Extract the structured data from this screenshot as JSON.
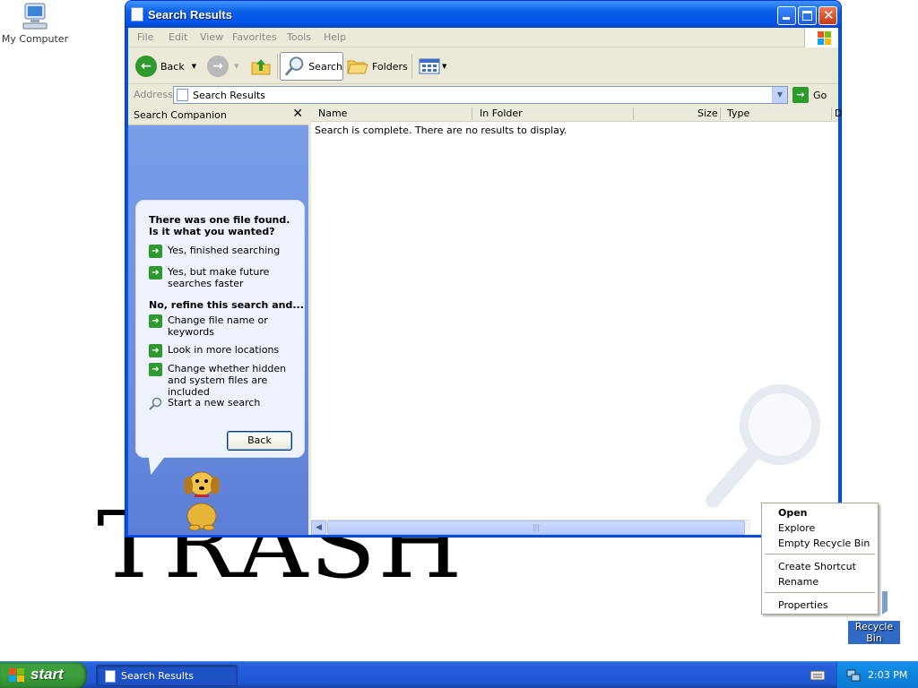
{
  "desktop": {
    "my_computer_label": "My Computer",
    "recycle_bin_label": "Recycle Bin",
    "trash_text": "TRASH"
  },
  "window": {
    "title": "Search Results",
    "menu": [
      "File",
      "Edit",
      "View",
      "Favorites",
      "Tools",
      "Help"
    ],
    "toolbar": {
      "back": "Back",
      "search": "Search",
      "folders": "Folders"
    },
    "address": {
      "label": "Address",
      "value": "Search Results",
      "go": "Go"
    },
    "companion": {
      "header": "Search Companion",
      "question": "There was one file found.  Is it what you wanted?",
      "options_yes": [
        "Yes, finished searching",
        "Yes, but make future searches faster"
      ],
      "refine_heading": "No, refine this search and...",
      "options_refine": [
        "Change file name or keywords",
        "Look in more locations",
        "Change whether hidden and system files are included"
      ],
      "new_search": "Start a new search",
      "back_button": "Back"
    },
    "results": {
      "columns": [
        "Name",
        "In Folder",
        "Size",
        "Type",
        "D"
      ],
      "message": "Search is complete. There are no results to display."
    }
  },
  "context_menu": {
    "items": [
      "Open",
      "Explore",
      "Empty Recycle Bin",
      "Create Shortcut",
      "Rename",
      "Properties"
    ]
  },
  "taskbar": {
    "start": "start",
    "task": "Search Results",
    "clock": "2:03 PM"
  },
  "colors": {
    "title_blue": "#0055ea",
    "start_green": "#3c9e3c",
    "arrow_green": "#2e9a2e"
  }
}
